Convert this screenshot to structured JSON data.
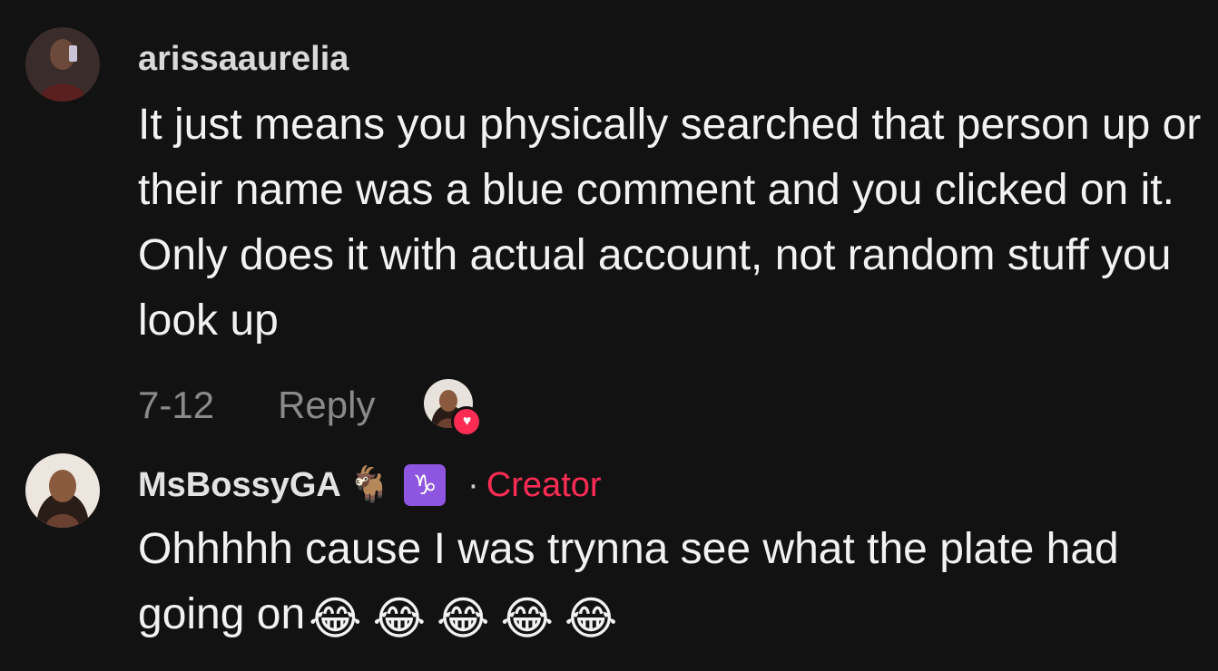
{
  "comments": [
    {
      "username": "arissaaurelia",
      "text": "It just means you physically searched that person up or their name was a blue comment and you clicked on it. Only does it with actual account, not random stuff you look up",
      "date": "7-12",
      "reply_label": "Reply",
      "liked_by_creator": true,
      "heart_icon": "heart-icon"
    },
    {
      "username": "MsBossyGA",
      "badge_goat": "🐐",
      "badge_zodiac": "♑",
      "separator": "·",
      "role": "Creator",
      "text": "Ohhhhh cause I was trynna see what the plate had going on",
      "emojis": [
        "😂",
        "😂",
        "😂",
        "😂",
        "😂"
      ]
    }
  ],
  "colors": {
    "background": "#121212",
    "creator_accent": "#fe2c55",
    "zodiac_badge": "#8e55e0",
    "meta_text": "#8a8a8a"
  }
}
